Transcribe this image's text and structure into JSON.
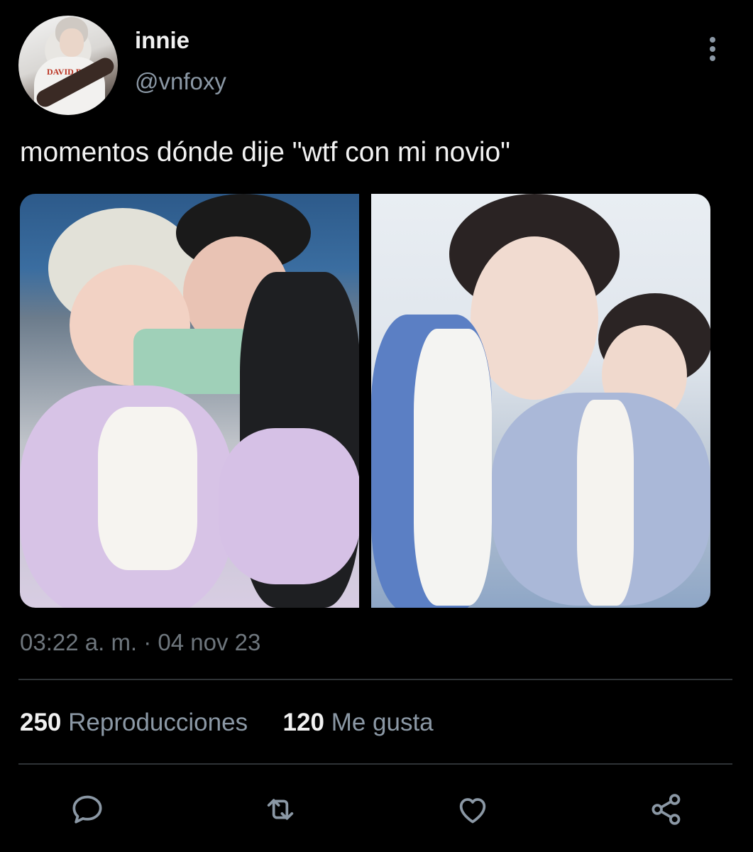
{
  "tweet": {
    "author_name": "innie",
    "author_handle": "@vnfoxy",
    "text": "momentos dónde dije \"wtf con mi novio\"",
    "avatar_print": "DAVID BOWIE",
    "timestamp": "03:22 a. m. · 04 nov 23",
    "views_count": "250",
    "views_label": "Reproducciones",
    "likes_count": "120",
    "likes_label": "Me gusta"
  },
  "icons": {
    "more": "more-vertical-icon",
    "reply": "reply-icon",
    "retweet": "retweet-icon",
    "like": "heart-icon",
    "share": "share-icon"
  },
  "colors": {
    "background": "#000000",
    "text": "#e7e9ea",
    "muted": "#8b98a5",
    "divider": "#2f3336"
  }
}
